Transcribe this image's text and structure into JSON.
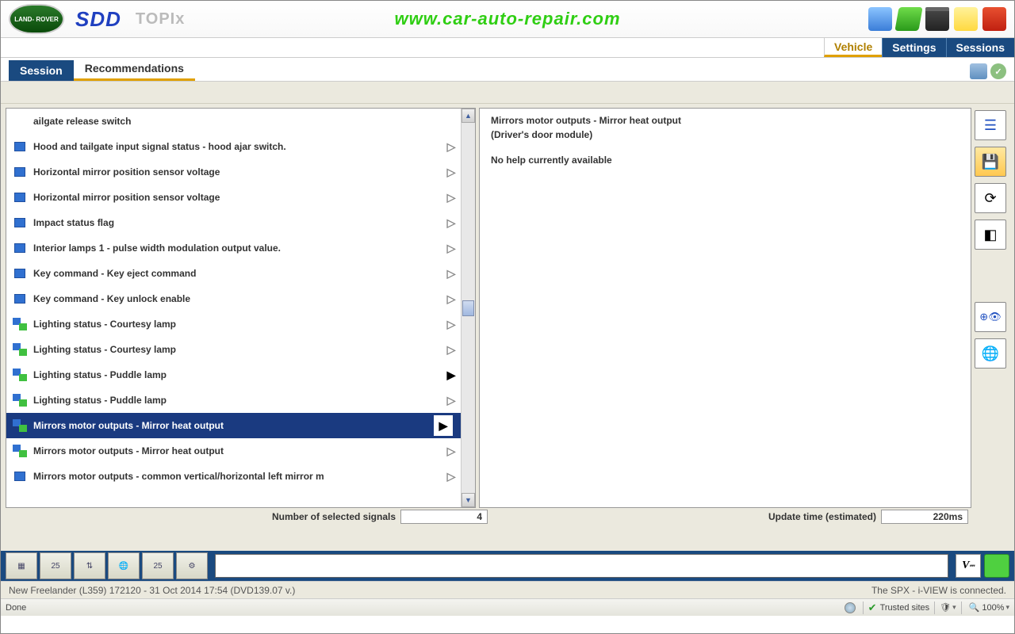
{
  "header": {
    "brand": "LAND-\nROVER",
    "sdd": "SDD",
    "topix": "TOPIx",
    "watermark": "www.car-auto-repair.com"
  },
  "nav": {
    "vehicle": "Vehicle",
    "settings": "Settings",
    "sessions": "Sessions"
  },
  "tabs": {
    "session": "Session",
    "recommendations": "Recommendations"
  },
  "signals": [
    {
      "icon": "none",
      "text": "ailgate release switch",
      "arrow": ""
    },
    {
      "icon": "mon",
      "text": "Hood and tailgate input signal status - hood ajar switch.",
      "arrow": "▷"
    },
    {
      "icon": "mon",
      "text": "Horizontal mirror position sensor voltage",
      "arrow": "▷"
    },
    {
      "icon": "mon",
      "text": "Horizontal mirror position sensor voltage",
      "arrow": "▷"
    },
    {
      "icon": "mon",
      "text": "Impact status flag",
      "arrow": "▷"
    },
    {
      "icon": "mon",
      "text": "Interior lamps 1 - pulse width modulation output value.",
      "arrow": "▷"
    },
    {
      "icon": "mon",
      "text": "Key command  -  Key eject command",
      "arrow": "▷"
    },
    {
      "icon": "mon",
      "text": "Key command  -  Key unlock enable",
      "arrow": "▷"
    },
    {
      "icon": "multi",
      "text": "Lighting status  -  Courtesy lamp",
      "arrow": "▷"
    },
    {
      "icon": "multi",
      "text": "Lighting status  -  Courtesy lamp",
      "arrow": "▷"
    },
    {
      "icon": "multi",
      "text": "Lighting status  -  Puddle lamp",
      "arrow": "▶"
    },
    {
      "icon": "multi",
      "text": "Lighting status  -  Puddle lamp",
      "arrow": "▷"
    },
    {
      "icon": "multi",
      "text": "Mirrors motor outputs  -  Mirror heat output",
      "arrow": "▶",
      "selected": true
    },
    {
      "icon": "multi",
      "text": "Mirrors motor outputs  -  Mirror heat output",
      "arrow": "▷"
    },
    {
      "icon": "mon",
      "text": "Mirrors motor outputs - common vertical/horizontal left mirror m",
      "arrow": "▷"
    }
  ],
  "detail": {
    "title": "Mirrors motor outputs  -  Mirror heat output",
    "module": "(Driver's door module)",
    "help": "No help currently available"
  },
  "status": {
    "left_label": "Number of selected signals",
    "left_value": "4",
    "right_label": "Update time (estimated)",
    "right_value": "220ms"
  },
  "footer1": {
    "left": "New Freelander (L359) 172120 - 31 Oct 2014 17:54 (DVD139.07 v.)",
    "right": "The SPX - i-VIEW is connected."
  },
  "footer2": {
    "done": "Done",
    "trusted": "Trusted sites",
    "zoom": "100%"
  },
  "vlabel": "V"
}
